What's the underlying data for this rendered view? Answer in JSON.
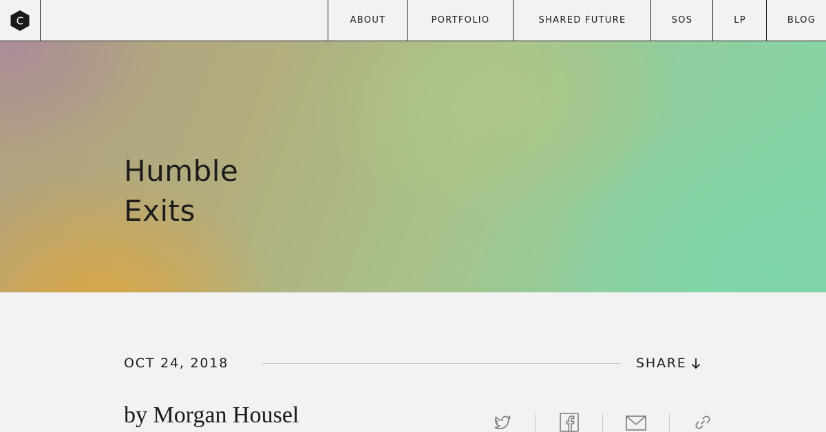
{
  "header": {
    "logo_letter": "C",
    "logo_icon": "hexagon-c-logo",
    "nav": [
      {
        "label": "ABOUT"
      },
      {
        "label": "PORTFOLIO"
      },
      {
        "label": "SHARED FUTURE"
      },
      {
        "label": "SOS"
      },
      {
        "label": "LP"
      },
      {
        "label": "BLOG"
      }
    ]
  },
  "hero": {
    "title_line1": "Humble",
    "title_line2": "Exits",
    "colors": {
      "warm": "#d9a649",
      "green": "#82d5a8",
      "mauve": "#aa8c98",
      "olive": "#b0c888"
    }
  },
  "article": {
    "date": "OCT 24, 2018",
    "share_label": "SHARE",
    "share_icon": "arrow-down-icon",
    "author": "by Morgan Housel",
    "share_icons": [
      "twitter-icon",
      "facebook-icon",
      "mail-icon",
      "link-icon"
    ]
  }
}
